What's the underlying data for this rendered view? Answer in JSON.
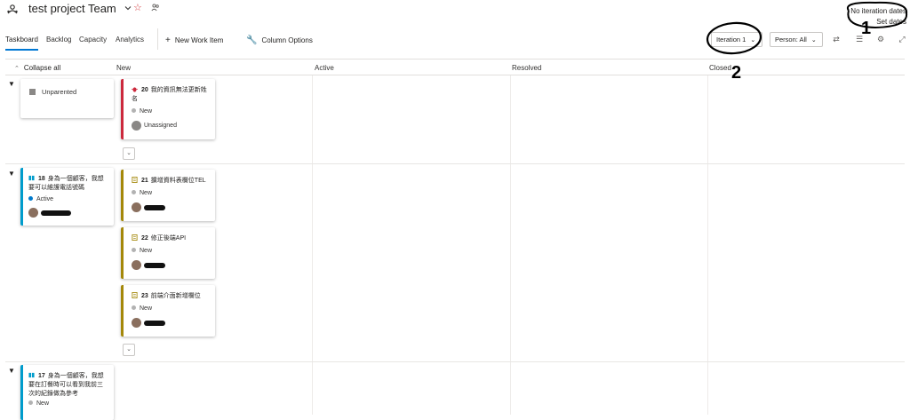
{
  "header": {
    "team_title": "test project Team",
    "iteration_dates": "No iteration dates",
    "set_dates": "Set dates"
  },
  "toolbar": {
    "tabs": [
      "Taskboard",
      "Backlog",
      "Capacity",
      "Analytics"
    ],
    "new_work_item": "New Work Item",
    "column_options": "Column Options",
    "iteration": "Iteration 1",
    "person": "Person: All"
  },
  "board": {
    "collapse_all": "Collapse all",
    "columns": [
      "New",
      "Active",
      "Resolved",
      "Closed"
    ],
    "rows": [
      {
        "parent": {
          "label": "Unparented"
        },
        "tasks": [
          {
            "id": "20",
            "title": "我的資訊無法更新姓名",
            "state": "New",
            "assignee": "Unassigned",
            "type": "bug"
          }
        ]
      },
      {
        "parent": {
          "id": "18",
          "title": "身為一個顧客，我想要可以維護電話號碼",
          "state": "Active"
        },
        "tasks": [
          {
            "id": "21",
            "title": "擴增資料表欄位TEL",
            "state": "New",
            "type": "task"
          },
          {
            "id": "22",
            "title": "修正後端API",
            "state": "New",
            "type": "task"
          },
          {
            "id": "23",
            "title": "前端介面新增欄位",
            "state": "New",
            "type": "task"
          }
        ]
      },
      {
        "parent": {
          "id": "17",
          "title": "身為一個顧客，我想要在訂餐時可以看到我前三次的紀錄做為參考",
          "state": "New"
        },
        "tasks": []
      }
    ]
  },
  "annotations": {
    "label_1": "1",
    "label_2": "2"
  },
  "colors": {
    "accent": "#0078d4",
    "bug": "#cc293d",
    "task": "#a4880a",
    "story": "#009ccc",
    "active_dot": "#007acc",
    "new_dot": "#b2b2b2"
  },
  "icons": [
    "team-icon",
    "chevron-down-icon",
    "star-icon",
    "people-icon",
    "plus-icon",
    "wrench-icon",
    "filter-icon",
    "list-icon",
    "gear-icon",
    "expand-icon",
    "bug-icon",
    "task-icon",
    "story-icon"
  ]
}
